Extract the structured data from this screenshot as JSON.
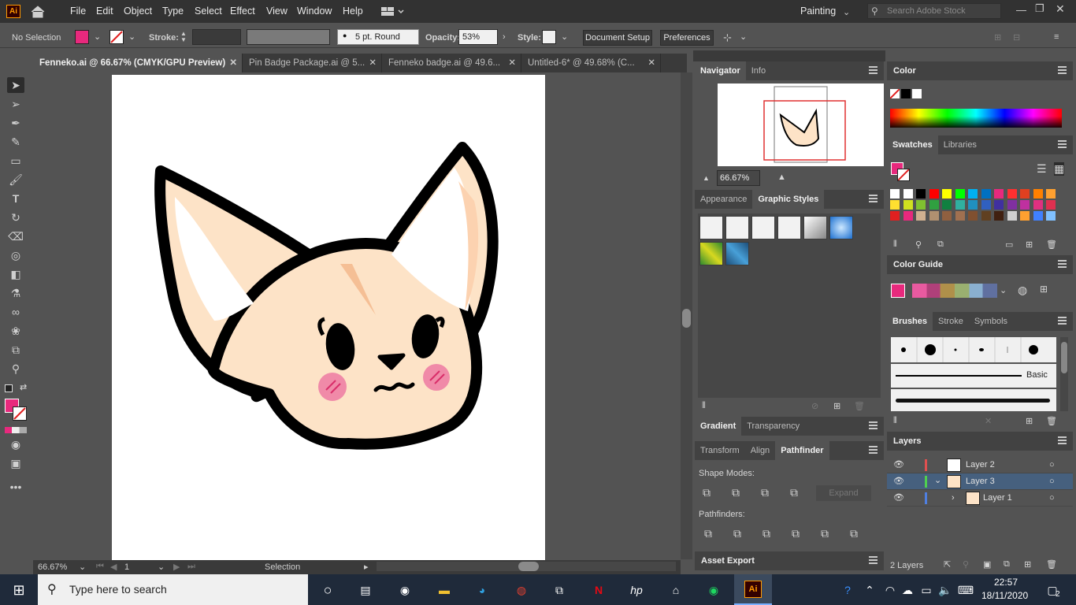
{
  "menu": {
    "logo": "Ai",
    "items": [
      "File",
      "Edit",
      "Object",
      "Type",
      "Select",
      "Effect",
      "View",
      "Window",
      "Help"
    ],
    "workspace": "Painting",
    "search_placeholder": "Search Adobe Stock"
  },
  "control": {
    "selection": "No Selection",
    "stroke_label": "Stroke:",
    "brush": "5 pt. Round",
    "opacity_label": "Opacity:",
    "opacity_value": "53%",
    "style_label": "Style:",
    "doc_setup": "Document Setup",
    "preferences": "Preferences",
    "fill_color": "#e8297d"
  },
  "tabs": [
    {
      "label": "Fenneko.ai @ 66.67% (CMYK/GPU Preview)",
      "active": true
    },
    {
      "label": "Pin Badge Package.ai @ 5..."
    },
    {
      "label": "Fenneko badge.ai @ 49.6..."
    },
    {
      "label": "Untitled-6* @ 49.68% (C..."
    }
  ],
  "status": {
    "zoom": "66.67%",
    "page": "1",
    "tool": "Selection"
  },
  "navigator": {
    "tabs": [
      "Navigator",
      "Info"
    ],
    "zoom": "66.67%"
  },
  "appearance": {
    "tabs": [
      "Appearance",
      "Graphic Styles"
    ]
  },
  "gradient": {
    "tabs": [
      "Gradient",
      "Transparency"
    ]
  },
  "pathfinder": {
    "tabs": [
      "Transform",
      "Align",
      "Pathfinder"
    ],
    "shape_modes": "Shape Modes:",
    "expand": "Expand",
    "pathfinders": "Pathfinders:"
  },
  "asset_export": "Asset Export",
  "color": {
    "title": "Color"
  },
  "swatches": {
    "tabs": [
      "Swatches",
      "Libraries"
    ]
  },
  "color_guide": {
    "title": "Color Guide"
  },
  "brushes": {
    "tabs": [
      "Brushes",
      "Stroke",
      "Symbols"
    ],
    "basic": "Basic"
  },
  "layers": {
    "title": "Layers",
    "items": [
      {
        "name": "Layer 2",
        "color": "#e05050"
      },
      {
        "name": "Layer 3",
        "color": "#4fd04f"
      },
      {
        "name": "Layer 1",
        "color": "#4f7fe0"
      }
    ],
    "count": "2 Layers"
  },
  "taskbar": {
    "search_placeholder": "Type here to search",
    "time": "22:57",
    "date": "18/11/2020",
    "notifications": "2"
  },
  "colors": {
    "accent": "#e8297d",
    "fox_face": "#fde3c7",
    "fox_inner_ear": "#fcd2b0",
    "fox_outline": "#000000",
    "blush": "#f08aa8"
  }
}
